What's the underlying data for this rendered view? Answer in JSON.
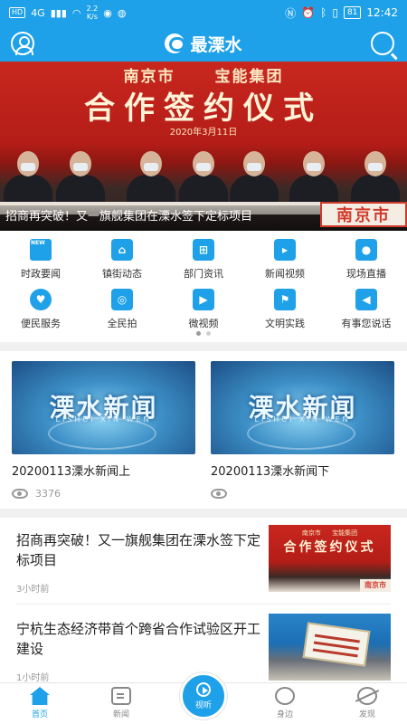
{
  "status_bar": {
    "network_badge": "HD",
    "signal": "4G",
    "speed_value": "2.2",
    "speed_unit": "K/s",
    "battery": "81",
    "time": "12:42"
  },
  "header": {
    "app_name": "最溧水"
  },
  "banner": {
    "line1": "南京市  宝能集团",
    "line2": "合作签约仪式",
    "date": "2020年3月11日",
    "caption": "招商再突破！又一旗舰集团在溧水签下定标项目",
    "badge": "南京市"
  },
  "services": [
    {
      "label": "时政要闻",
      "icon": "news-paper-icon"
    },
    {
      "label": "镇街动态",
      "icon": "town-house-icon"
    },
    {
      "label": "部门资讯",
      "icon": "org-chart-icon"
    },
    {
      "label": "新闻视频",
      "icon": "video-play-icon"
    },
    {
      "label": "现场直播",
      "icon": "live-camera-icon"
    },
    {
      "label": "便民服务",
      "icon": "helping-hands-icon"
    },
    {
      "label": "全民拍",
      "icon": "camera-icon"
    },
    {
      "label": "微视频",
      "icon": "clapper-icon"
    },
    {
      "label": "文明实践",
      "icon": "flag-icon"
    },
    {
      "label": "有事您说话",
      "icon": "megaphone-icon"
    }
  ],
  "videos": [
    {
      "thumb_title": "溧水新闻",
      "thumb_sub": "LISHUI XIN WEN",
      "title": "20200113溧水新闻上",
      "views": "3376"
    },
    {
      "thumb_title": "溧水新闻",
      "thumb_sub": "LISHUI XIN WEN",
      "title": "20200113溧水新闻下",
      "views": ""
    }
  ],
  "news": [
    {
      "title": "招商再突破！又一旗舰集团在溧水签下定标项目",
      "time": "3小时前",
      "img_line1": "南京市  宝能集团",
      "img_line2": "合作签约仪式",
      "img_badge": "南京市"
    },
    {
      "title": "宁杭生态经济带首个跨省合作试验区开工建设",
      "time": "1小时前"
    }
  ],
  "tabs": [
    {
      "label": "首页"
    },
    {
      "label": "新闻"
    },
    {
      "label": "视听"
    },
    {
      "label": "身边"
    },
    {
      "label": "发现"
    }
  ],
  "colors": {
    "brand": "#1ea1e8"
  }
}
